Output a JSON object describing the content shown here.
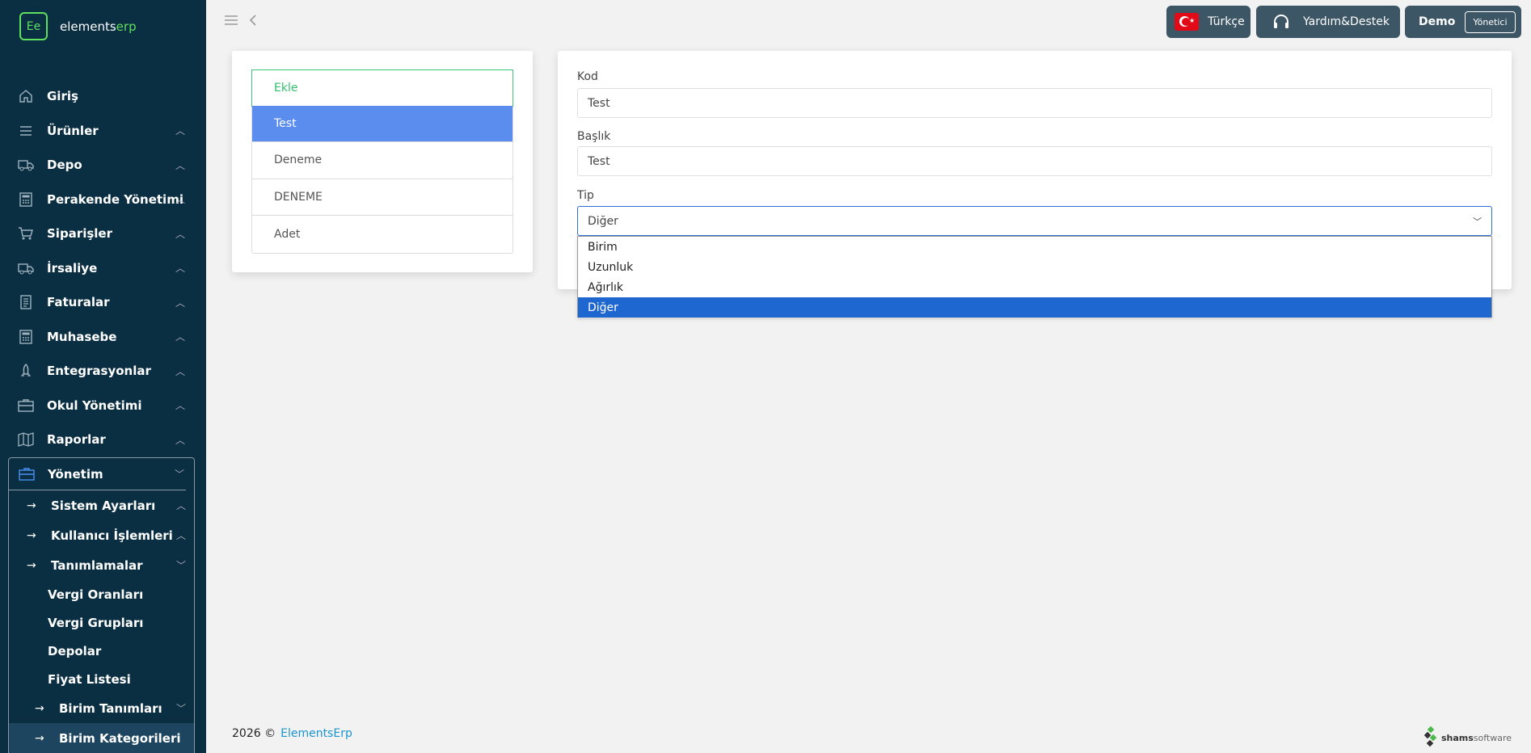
{
  "app": {
    "logo_mark": "Ee",
    "logo_text_main": "elements",
    "logo_text_accent": "erp"
  },
  "sidebar": {
    "items": [
      {
        "label": "Giriş",
        "icon": "home-icon",
        "has_chevron": false
      },
      {
        "label": "Ürünler",
        "icon": "list-icon",
        "has_chevron": true
      },
      {
        "label": "Depo",
        "icon": "truck-icon",
        "has_chevron": true
      },
      {
        "label": "Perakende Yönetimi",
        "icon": "calculator-icon",
        "has_chevron": true
      },
      {
        "label": "Siparişler",
        "icon": "cart-icon",
        "has_chevron": true
      },
      {
        "label": "İrsaliye",
        "icon": "truck-icon",
        "has_chevron": true
      },
      {
        "label": "Faturalar",
        "icon": "document-icon",
        "has_chevron": true
      },
      {
        "label": "Muhasebe",
        "icon": "calculator-icon",
        "has_chevron": true
      },
      {
        "label": "Entegrasyonlar",
        "icon": "rocket-icon",
        "has_chevron": true
      },
      {
        "label": "Okul Yönetimi",
        "icon": "briefcase-icon",
        "has_chevron": true
      },
      {
        "label": "Raporlar",
        "icon": "map-icon",
        "has_chevron": true
      }
    ],
    "yonetim": {
      "label": "Yönetim",
      "sub": [
        {
          "label": "Sistem Ayarları",
          "chevron": "up"
        },
        {
          "label": "Kullanıcı İşlemleri",
          "chevron": "up"
        },
        {
          "label": "Tanımlamalar",
          "chevron": "down"
        }
      ],
      "leaves": [
        "Vergi Oranları",
        "Vergi Grupları",
        "Depolar",
        "Fiyat Listesi"
      ],
      "sub2": [
        {
          "label": "Birim Tanımları"
        },
        {
          "label": "Birim Kategorileri"
        }
      ]
    }
  },
  "topbar": {
    "language": "Türkçe",
    "support": "Yardım&Destek",
    "user_name": "Demo",
    "user_role": "Yönetici"
  },
  "list": {
    "add_label": "Ekle",
    "items": [
      "Test",
      "Deneme",
      "DENEME",
      "Adet"
    ],
    "selected_index": 0
  },
  "form": {
    "kod_label": "Kod",
    "kod_value": "Test",
    "baslik_label": "Başlık",
    "baslik_value": "Test",
    "tip_label": "Tip",
    "tip_value": "Diğer",
    "tip_options": [
      "Birim",
      "Uzunluk",
      "Ağırlık",
      "Diğer"
    ],
    "tip_selected_index": 3
  },
  "footer": {
    "year": "2026 ©",
    "link": "ElementsErp",
    "brand_main": "shams",
    "brand_accent": "software"
  },
  "colors": {
    "sidebar_bg": "#0a2e42",
    "accent_green": "#5ee05e",
    "selected_blue": "#5b8def",
    "dropdown_selected": "#1e66d0",
    "link": "#1a95d0"
  }
}
